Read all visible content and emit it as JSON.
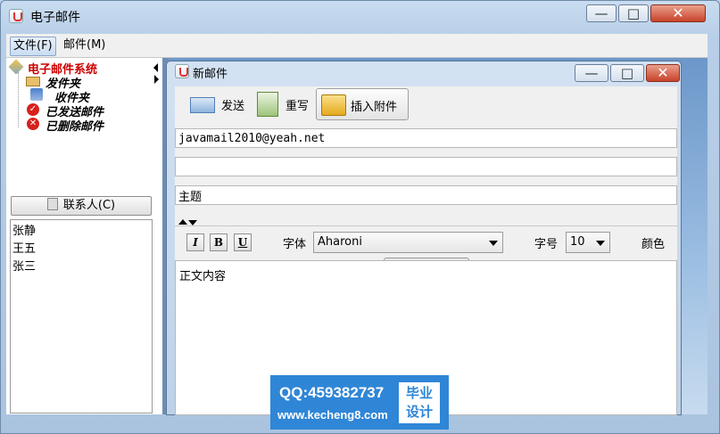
{
  "window": {
    "title": "电子邮件",
    "minimize_glyph": "—",
    "maximize_glyph": "□",
    "close_glyph": "✕"
  },
  "menubar": {
    "items": [
      {
        "label": "文件(F)"
      },
      {
        "label": "邮件(M)"
      }
    ]
  },
  "tree": {
    "root": "电子邮件系统",
    "items": [
      {
        "label": "发件夹",
        "icon": "envelope-icon"
      },
      {
        "label": "收件夹",
        "icon": "inbox-download-icon"
      },
      {
        "label": "已发送邮件",
        "icon": "sent-check-icon"
      },
      {
        "label": "已删除邮件",
        "icon": "deleted-x-icon"
      }
    ]
  },
  "contacts": {
    "button_label": "联系人(C)",
    "list": [
      "张静",
      "王五",
      "张三"
    ]
  },
  "compose": {
    "title": "新邮件",
    "toolbar": {
      "send": "发送",
      "rewrite": "重写",
      "attach": "插入附件"
    },
    "to": "javamail2010@yeah.net",
    "cc": "",
    "subject": "主题",
    "format": {
      "italic": "I",
      "bold": "B",
      "underline": "U",
      "font_label": "字体",
      "font_value": "Aharoni",
      "size_label": "字号",
      "size_value": "10",
      "color_label": "颜色"
    },
    "body": "正文内容"
  },
  "watermark": {
    "qq": "QQ:459382737",
    "url": "www.kecheng8.com",
    "badge_line1": "毕业",
    "badge_line2": "设计"
  },
  "colors": {
    "tree_root": "#cc0000",
    "desktop_blue": "#6c97c9",
    "watermark_blue": "#2f86d6"
  }
}
